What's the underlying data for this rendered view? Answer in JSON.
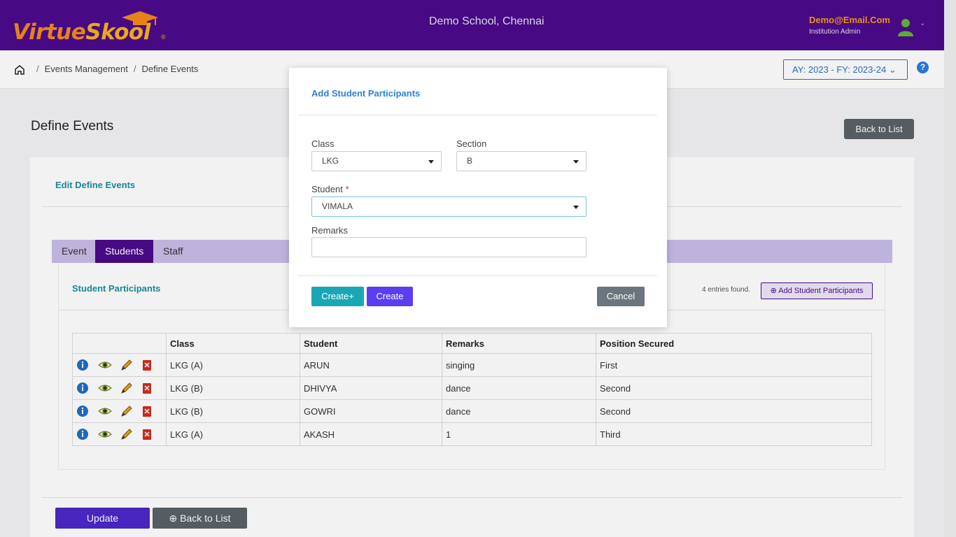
{
  "header": {
    "logo_text_1": "Virtue",
    "logo_text_2": "Skool",
    "logo_reg": "®",
    "school_name": "Demo School, Chennai",
    "user_email": "Demo@Email.Com",
    "user_role": "Institution Admin"
  },
  "breadcrumb": {
    "items": [
      "Events Management",
      "Define Events"
    ],
    "separator": "/"
  },
  "academic_year": "AY: 2023 - FY: 2023-24",
  "help_label": "?",
  "page_title": "Define Events",
  "back_to_list_label": "Back to List",
  "card": {
    "title": "Edit Define Events",
    "tabs": [
      "Event",
      "Students",
      "Staff"
    ],
    "active_tab": "Students",
    "participants_title": "Student Participants",
    "entries_text": "4 entries found.",
    "add_button_label": "Add Student Participants",
    "table": {
      "headers": [
        "",
        "Class",
        "Student",
        "Remarks",
        "Position Secured"
      ],
      "rows": [
        {
          "class": "LKG (A)",
          "student": "ARUN",
          "remarks": "singing",
          "position": "First"
        },
        {
          "class": "LKG (B)",
          "student": "DHIVYA",
          "remarks": "dance",
          "position": "Second"
        },
        {
          "class": "LKG (B)",
          "student": "GOWRI",
          "remarks": "dance",
          "position": "Second"
        },
        {
          "class": "LKG (A)",
          "student": "AKASH",
          "remarks": "1",
          "position": "Third"
        }
      ]
    },
    "update_label": "Update",
    "back_to_list_label": "Back to List"
  },
  "modal": {
    "title": "Add Student Participants",
    "class_label": "Class",
    "class_value": "LKG",
    "section_label": "Section",
    "section_value": "B",
    "student_label": "Student",
    "student_required": "*",
    "student_value": "VIMALA",
    "remarks_label": "Remarks",
    "remarks_value": "",
    "create_plus_label": "Create+",
    "create_label": "Create",
    "cancel_label": "Cancel"
  },
  "colors": {
    "header_bg": "#4b0a8c",
    "accent_teal": "#1a8fa0",
    "accent_blue": "#2f7fd8",
    "create_plus": "#1aa7b5",
    "create": "#5b3ef0",
    "cancel": "#6c757d"
  },
  "icons": {
    "row_actions": [
      "info-icon",
      "view-eye-icon",
      "edit-pencil-icon",
      "delete-icon"
    ]
  }
}
